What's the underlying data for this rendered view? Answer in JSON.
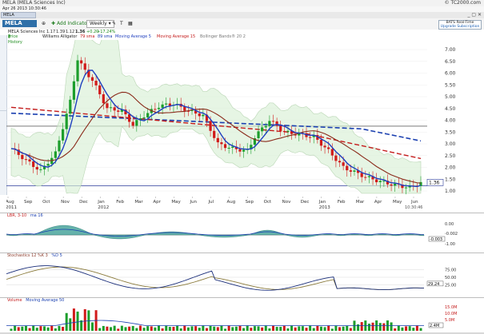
{
  "window": {
    "title": "MELA (MELA Sciences Inc)",
    "site": "© TC2000.com",
    "timestamp": "Apr 26 2013 10:30:46",
    "tab": "MELA"
  },
  "toolbar": {
    "symbol": "MELA",
    "zoom_label": "⊕",
    "add_indicator": "Add Indicator",
    "period": "Weekly",
    "realtime_badge": "BATS Real-Time",
    "upgrade": "Upgrade Subscription"
  },
  "legend": {
    "company": "MELA Sciences Inc",
    "open": "1.17",
    "high": "1.39",
    "low": "1.12",
    "close": "1.36",
    "change": "+0.20",
    "change_pct": "+17.24%",
    "price_history": "Price History",
    "alligator": "Williams Alligator",
    "sma79": "79 sma",
    "sma89": "89 sma",
    "ma5": "Moving Average 5",
    "ma15": "Moving Average 15",
    "bbands": "Bollinger Bands® 20 2"
  },
  "side_tabs": [
    "Watchlist / Screen Bars",
    "Watchlist / Screen Bars"
  ],
  "price_axis": [
    "7.00",
    "6.50",
    "6.00",
    "5.50",
    "5.00",
    "4.50",
    "4.00",
    "3.50",
    "3.00",
    "2.50",
    "2.00",
    "1.50",
    "1.00"
  ],
  "last_price": "1.36",
  "time_axis": [
    "Aug",
    "Sep",
    "Oct",
    "Nov",
    "Dec",
    "Jan",
    "Feb",
    "Mar",
    "Apr",
    "May",
    "Jun",
    "Jul",
    "Aug",
    "Sep",
    "Oct",
    "Nov",
    "Dec",
    "Jan",
    "Feb",
    "Mar",
    "Apr",
    "May",
    "Jun"
  ],
  "year_labels": [
    "2011",
    "2012",
    "2013"
  ],
  "cursor_time": "10:30:46",
  "lbr": {
    "label": "LBR, 3-10",
    "ma": "ma 16",
    "axis": [
      "0.00",
      "-0.002",
      "-1.00"
    ],
    "value": "-0.003"
  },
  "stoch": {
    "label": "Stochastics 12 %K 3",
    "d": "%D 5",
    "axis": [
      "75.00",
      "50.00",
      "25.00"
    ],
    "value": "29.24"
  },
  "volume": {
    "label": "Volume",
    "ma": "Moving Average 50",
    "axis": [
      "15.0M",
      "10.0M",
      "5.0M"
    ],
    "value": "2.4M"
  },
  "colors": {
    "ma5": "#1f3fbf",
    "ma15": "#8b2b1b",
    "sma79": "#c41b1b",
    "sma89": "#1a3fb0",
    "band_fill": "#d8efd6",
    "candle_up": "#1c9e2c",
    "candle_down": "#d11a1a",
    "stoch_k": "#1a2e7a",
    "stoch_d": "#8a7a3a",
    "lbr_fill": "#4aa59c"
  }
}
